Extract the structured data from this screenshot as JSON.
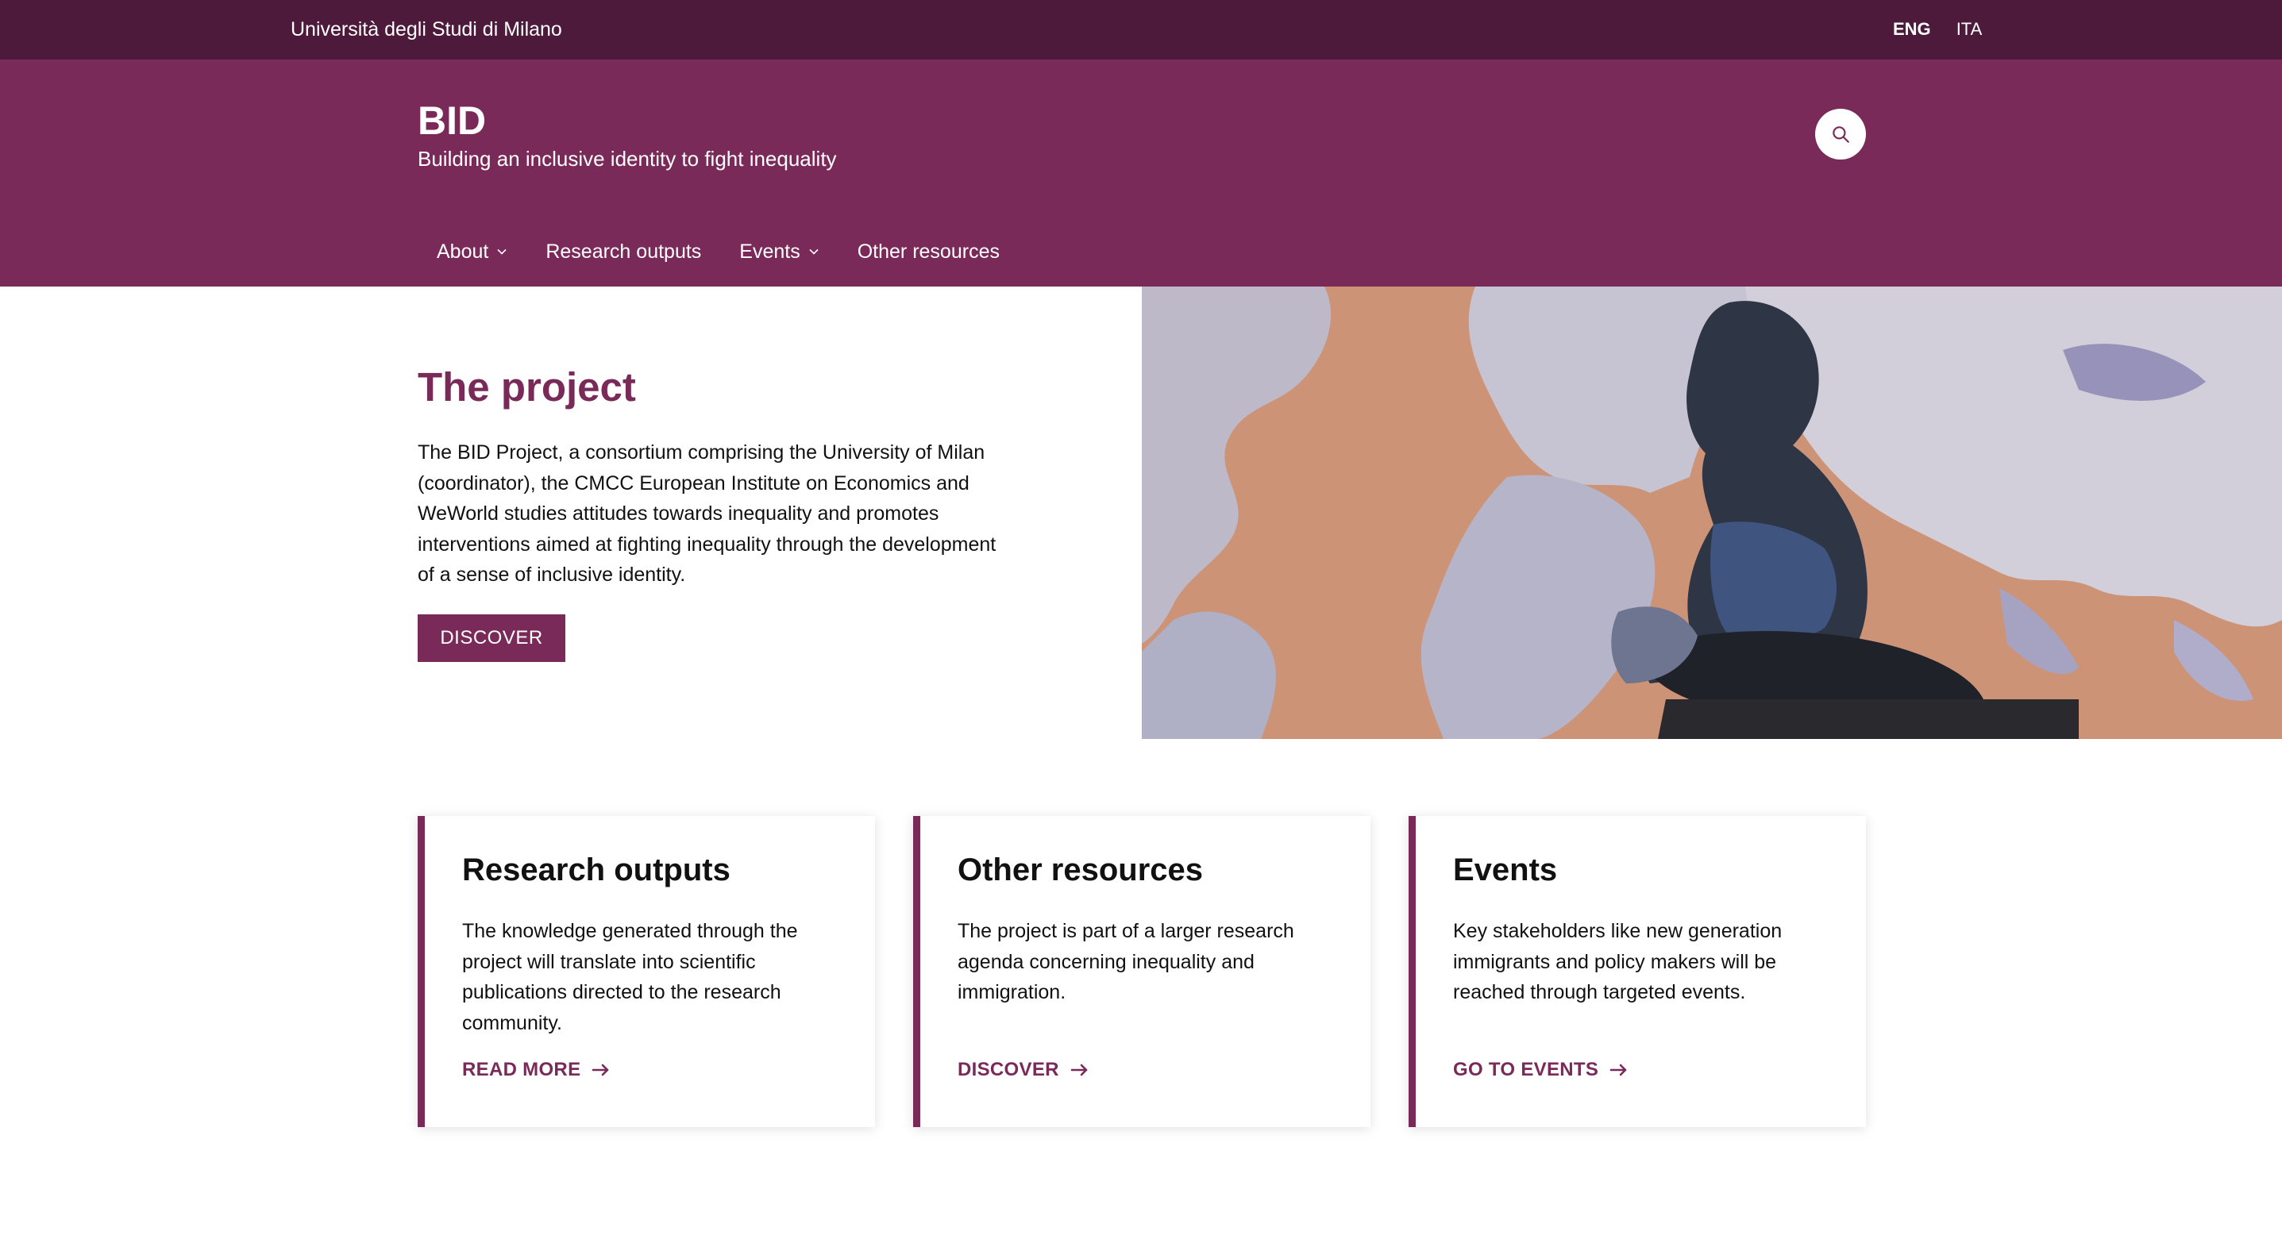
{
  "topbar": {
    "university": "Università degli Studi di Milano",
    "lang_active": "ENG",
    "lang_other": "ITA"
  },
  "header": {
    "title": "BID",
    "subtitle": "Building an inclusive identity to fight inequality"
  },
  "nav": {
    "items": [
      {
        "label": "About",
        "dropdown": true
      },
      {
        "label": "Research outputs",
        "dropdown": false
      },
      {
        "label": "Events",
        "dropdown": true
      },
      {
        "label": "Other resources",
        "dropdown": false
      }
    ]
  },
  "hero": {
    "title": "The project",
    "text": "The BID Project, a consortium comprising the University of Milan (coordinator), the CMCC European Institute on Economics and WeWorld studies attitudes towards inequality and promotes interventions aimed at fighting inequality through the development of a sense of inclusive identity.",
    "button_label": "DISCOVER"
  },
  "cards": [
    {
      "title": "Research outputs",
      "text": "The knowledge generated through the project will translate into scientific publications directed to the research community.",
      "link_label": "READ MORE"
    },
    {
      "title": "Other resources",
      "text": "The project is part of a larger research agenda concerning inequality and immigration.",
      "link_label": "DISCOVER"
    },
    {
      "title": "Events",
      "text": "Key stakeholders like new generation immigrants and policy makers will be reached through targeted events.",
      "link_label": "GO TO EVENTS"
    }
  ],
  "colors": {
    "topbar": "#4d1a3c",
    "brand": "#792a59"
  },
  "icons": {
    "search": "search-icon",
    "chevron": "chevron-down-icon",
    "arrow": "arrow-right-icon"
  }
}
